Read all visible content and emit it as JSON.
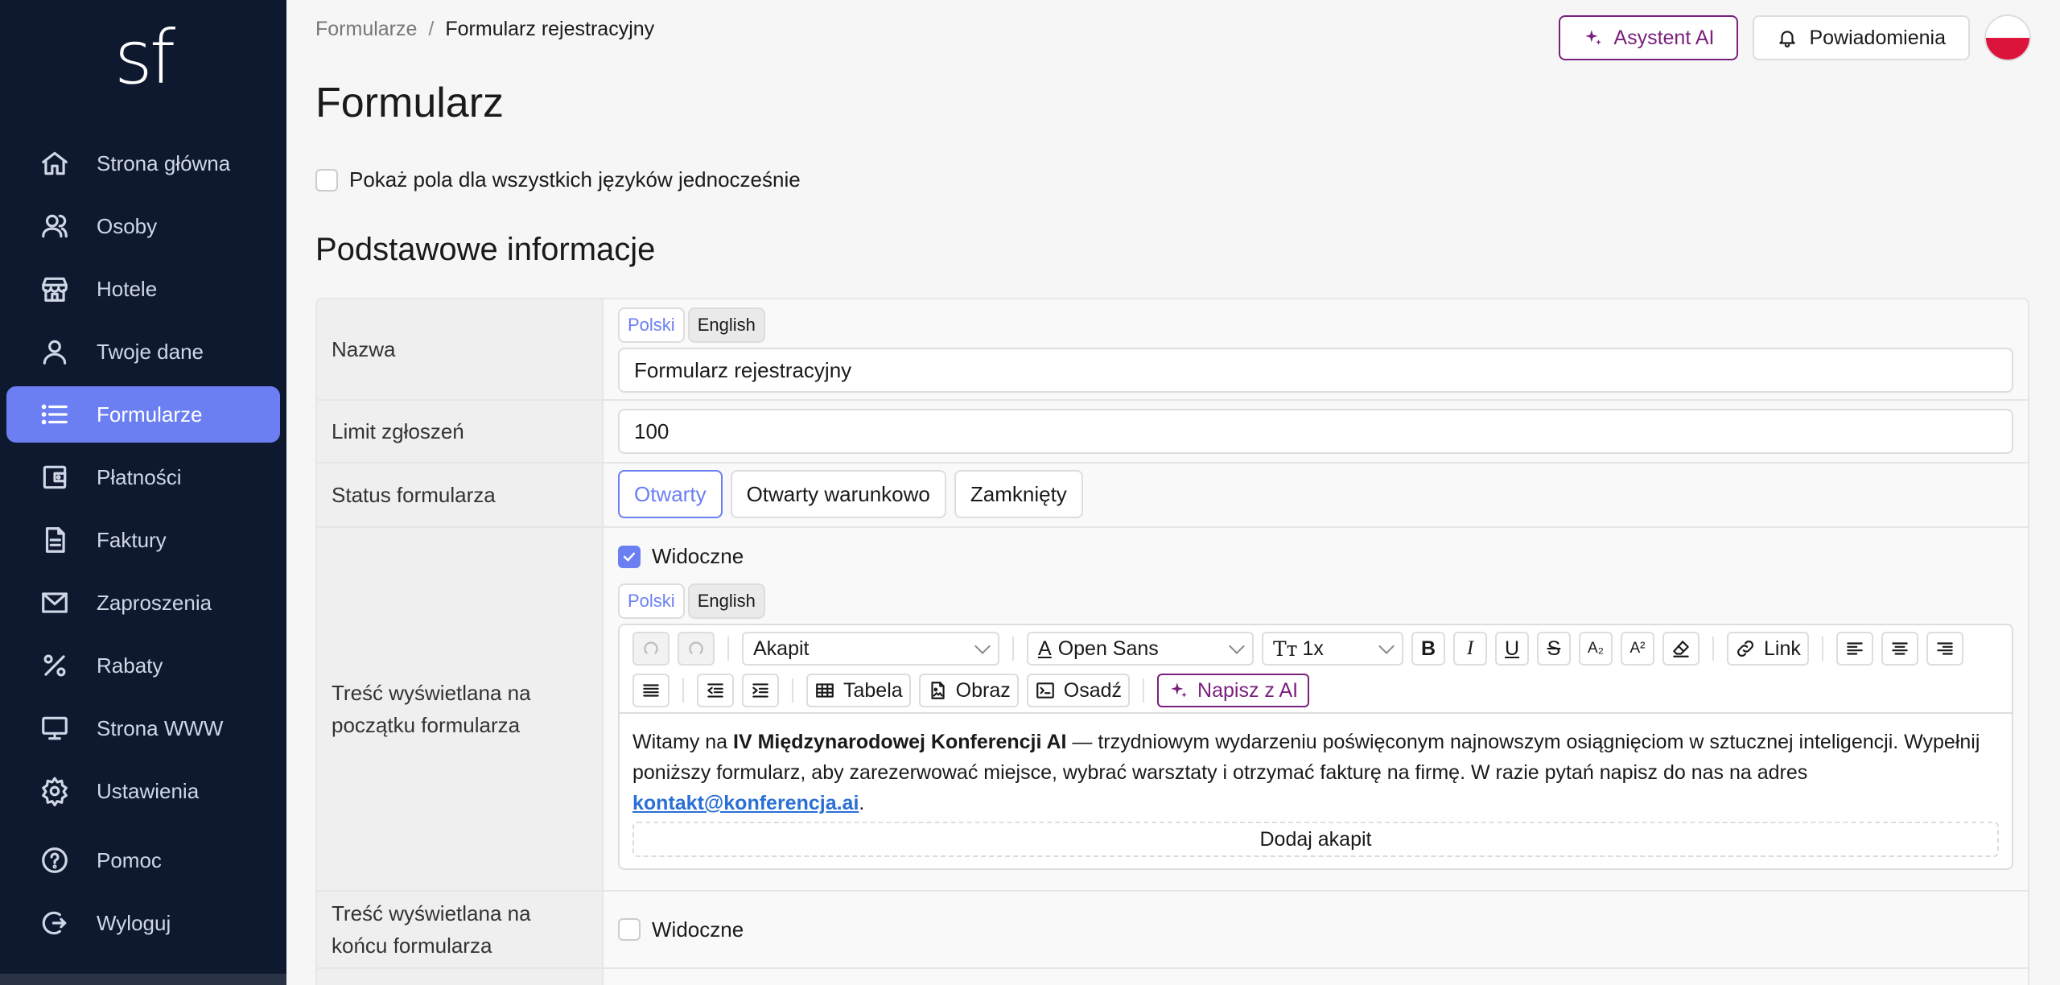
{
  "app": {
    "logo_text": "sf"
  },
  "sidebar": {
    "items": [
      {
        "label": "Strona główna",
        "icon": "home-icon"
      },
      {
        "label": "Osoby",
        "icon": "users-icon"
      },
      {
        "label": "Hotele",
        "icon": "hotel-icon"
      },
      {
        "label": "Twoje dane",
        "icon": "user-icon"
      },
      {
        "label": "Formularze",
        "icon": "list-icon",
        "active": true
      },
      {
        "label": "Płatności",
        "icon": "wallet-icon"
      },
      {
        "label": "Faktury",
        "icon": "invoice-icon"
      },
      {
        "label": "Zaproszenia",
        "icon": "mail-icon"
      },
      {
        "label": "Rabaty",
        "icon": "percent-icon"
      },
      {
        "label": "Strona WWW",
        "icon": "monitor-icon"
      },
      {
        "label": "Ustawienia",
        "icon": "gear-icon"
      },
      {
        "label": "Pomoc",
        "icon": "help-icon"
      },
      {
        "label": "Wyloguj",
        "icon": "logout-icon"
      }
    ]
  },
  "header": {
    "breadcrumb_root": "Formularze",
    "breadcrumb_sep": "/",
    "breadcrumb_current": "Formularz rejestracyjny",
    "ai_button": "Asystent AI",
    "notifications_button": "Powiadomienia",
    "language_flag": "pl-flag"
  },
  "page": {
    "title": "Formularz",
    "show_all_languages_label": "Pokaż pola dla wszystkich języków jednocześnie",
    "section_title": "Podstawowe informacje"
  },
  "form": {
    "name": {
      "label": "Nazwa",
      "tabs": [
        "Polski",
        "English"
      ],
      "value": "Formularz rejestracyjny"
    },
    "limit": {
      "label": "Limit zgłoszeń",
      "value": "100"
    },
    "status": {
      "label": "Status formularza",
      "options": [
        "Otwarty",
        "Otwarty warunkowo",
        "Zamknięty"
      ],
      "selected": "Otwarty"
    },
    "intro": {
      "label": "Treść wyświetlana na początku formularza",
      "visible_label": "Widoczne",
      "visible": true,
      "tabs": [
        "Polski",
        "English"
      ],
      "toolbar": {
        "paragraph_select": "Akapit",
        "font_select": "Open Sans",
        "size_select": "1x",
        "link": "Link",
        "table": "Tabela",
        "image": "Obraz",
        "embed": "Osadź",
        "ai_write": "Napisz z AI"
      },
      "content": {
        "p1_pre": "Witamy na ",
        "p1_bold": "IV Międzynarodowej Konferencji AI",
        "p1_post": " — trzydniowym wydarzeniu poświęconym najnowszym osiągnięciom w sztucznej inteligencji. Wypełnij poniższy formularz, aby zarezerwować miejsce, wybrać warsztaty i otrzymać fakturę na firmę. W razie pytań napisz do nas na adres ",
        "link": "kontakt@konferencja.ai",
        "p1_end": "."
      },
      "add_paragraph": "Dodaj akapit"
    },
    "outro": {
      "label": "Treść wyświetlana na końcu formularza",
      "visible_label": "Widoczne",
      "visible": false
    }
  },
  "colors": {
    "sidebar_bg": "#0e1930",
    "accent": "#6b7ff2",
    "ai_purple": "#7a1f7c"
  }
}
